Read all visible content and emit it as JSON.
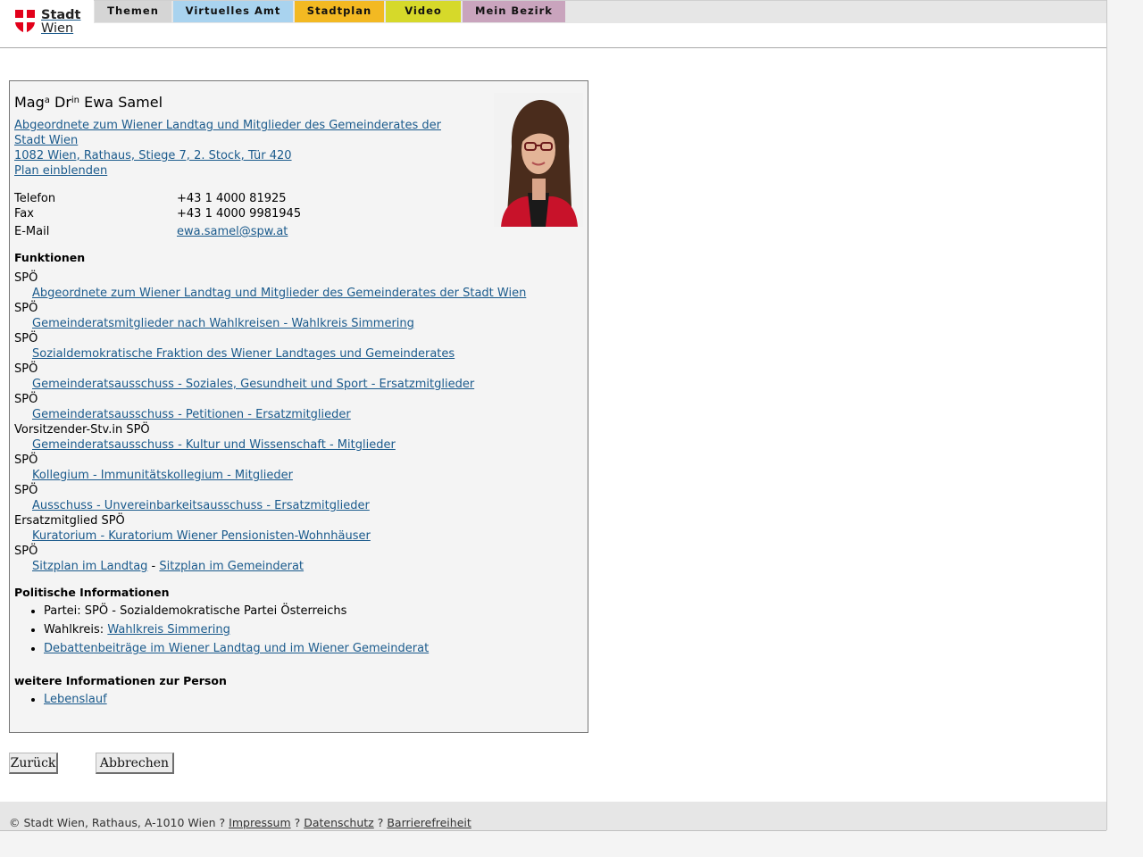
{
  "header": {
    "logo": {
      "line1": "Stadt",
      "line2": "Wien"
    },
    "tabs": [
      {
        "label": "Themen",
        "color": "#d5d5d5"
      },
      {
        "label": "Virtuelles Amt",
        "color": "#a9d3ef"
      },
      {
        "label": "Stadtplan",
        "color": "#f3b922"
      },
      {
        "label": "Video",
        "color": "#d6d92a"
      },
      {
        "label": "Mein Bezirk",
        "color": "#c9a4bd"
      }
    ]
  },
  "person": {
    "title_pre": "Mag",
    "title_pre_sup": "a",
    "title_dr": " Dr",
    "title_dr_sup": "in",
    "name": " Ewa Samel",
    "role_link_line1": "Abgeordnete zum Wiener Landtag und Mitglieder des Gemeinderates der",
    "role_link_line2": "Stadt Wien ",
    "address": "1082 Wien, Rathaus, Stiege 7, 2. Stock, Tür 420",
    "plan_link": "Plan einblenden",
    "photo_alt": "portrait-photo"
  },
  "contact": {
    "phone_label": "Telefon",
    "phone": "+43 1 4000 81925",
    "fax_label": "Fax",
    "fax": "+43 1 4000 9981945",
    "email_label": "E-Mail",
    "email": "ewa.samel@spw.at"
  },
  "functions": {
    "heading": "Funktionen",
    "items": [
      {
        "role": "SPÖ",
        "link": "Abgeordnete zum Wiener Landtag und Mitglieder des Gemeinderates der Stadt Wien"
      },
      {
        "role": "SPÖ",
        "link": "Gemeinderatsmitglieder nach Wahlkreisen - Wahlkreis Simmering"
      },
      {
        "role": "SPÖ",
        "link": "Sozialdemokratische Fraktion des Wiener Landtages und Gemeinderates"
      },
      {
        "role": "SPÖ",
        "link": "Gemeinderatsausschuss - Soziales, Gesundheit und Sport - Ersatzmitglieder"
      },
      {
        "role": "SPÖ",
        "link": "Gemeinderatsausschuss - Petitionen - Ersatzmitglieder"
      },
      {
        "role": "Vorsitzender-Stv.in SPÖ",
        "link": "Gemeinderatsausschuss - Kultur und Wissenschaft - Mitglieder"
      },
      {
        "role": "SPÖ",
        "link": "Kollegium - Immunitätskollegium - Mitglieder"
      },
      {
        "role": "SPÖ",
        "link": "Ausschuss - Unvereinbarkeitsausschuss - Ersatzmitglieder"
      },
      {
        "role": "Ersatzmitglied SPÖ",
        "link": "Kuratorium - Kuratorium Wiener Pensionisten-Wohnhäuser"
      },
      {
        "role": "SPÖ",
        "link": ""
      }
    ],
    "sitzplan_landtag": "Sitzplan im Landtag",
    "sitzplan_sep": " - ",
    "sitzplan_gemeinderat": "Sitzplan im Gemeinderat"
  },
  "political": {
    "heading": "Politische Informationen",
    "party": "Partei: SPÖ - Sozialdemokratische Partei Österreichs",
    "district_label": "Wahlkreis: ",
    "district_link": "Wahlkreis Simmering",
    "debates_link": "Debattenbeiträge im Wiener Landtag und im Wiener Gemeinderat"
  },
  "more": {
    "heading": "weitere Informationen zur Person",
    "cv_link": "Lebenslauf"
  },
  "buttons": {
    "back": "Zurück",
    "cancel": "Abbrechen"
  },
  "footer": {
    "copyright": "© Stadt Wien, Rathaus, A-1010 Wien ? ",
    "impressum": "Impressum",
    "sep1": " ? ",
    "datenschutz": "Datenschutz",
    "sep2": " ? ",
    "barrierefreiheit": "Barrierefreiheit"
  }
}
